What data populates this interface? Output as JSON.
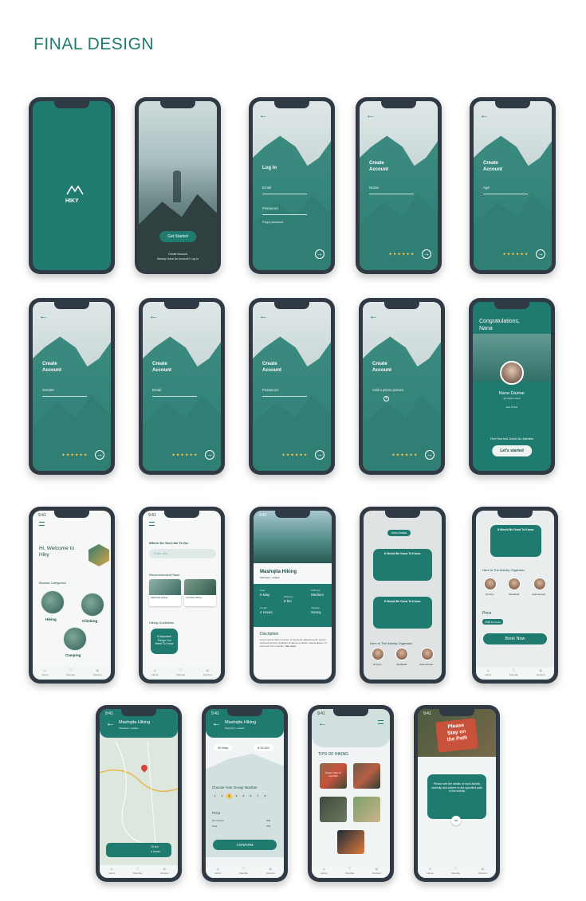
{
  "page": {
    "title": "FINAL DESIGN"
  },
  "colors": {
    "accent": "#1f7a6f",
    "dark": "#2f3a44",
    "star": "#f2c14e"
  },
  "splash": {
    "logo": "HIKY"
  },
  "onboarding": {
    "cta": "Get Started",
    "account_line": "Create Account",
    "signin_line": "Already Have An Account? Log In"
  },
  "login": {
    "title": "Log In",
    "email": "Email",
    "password": "Password",
    "forgot": "Forgot password"
  },
  "create": {
    "title_1": "Create",
    "title_2": "Account",
    "name": "Name",
    "age": "Age",
    "gender": "Gender",
    "email": "Email",
    "password": "Password",
    "photo": "Add a photo picture"
  },
  "steps": "✦✦✦✦✦✦",
  "congrats": {
    "title_1": "Congratulations,",
    "title_2": "Nana",
    "name": "Nana Dashar",
    "sub": "@ Nadine Nasa",
    "profile": "Edit Profile",
    "text": "Feel Free And Check Our Activities",
    "cta": "Let's started"
  },
  "home": {
    "time": "9:41",
    "greeting_1": "Hi, Welcome to",
    "greeting_2": "Hiky",
    "browse": "Browse Categories",
    "cat_1": "Hiking",
    "cat_2": "Climbing",
    "cat_3": "Camping"
  },
  "search": {
    "time": "9:41",
    "question": "Where Do You Like To Go:",
    "placeholder": "Enter city",
    "recommended": "Recommended Place",
    "place_1": "Mashqita Hiking",
    "place_2": "Fenawa Hiking",
    "guidelines": "Hiking Guidelines",
    "guide_card": "6 Important Things You Need To Know"
  },
  "detail": {
    "time": "9:41",
    "title": "Mashqita Hiking",
    "subtitle": "Mashqita / Latakia",
    "date_label": "Date",
    "date": "6 May",
    "distance_label": "Distance",
    "distance": "9 km",
    "difficulty_label": "Difficulty",
    "difficulty": "Medium",
    "length_label": "Length",
    "length": "4 Hours",
    "weather_label": "Weather",
    "weather": "Sunny",
    "desc_title": "Discription",
    "desc": "Lorem ipsum dolor sit amet, consectetur adipiscing elit, sed do eiusmod tempor incididunt ut labore et dolore magna aliqua. Ut enim ad minim veniam.",
    "see_more": "See more"
  },
  "activities": {
    "view_btn": "View Details",
    "card_1_title": "It Would Be Good To Know:",
    "card_2_title": "It Would Be Good To Know:",
    "organiser": "Here Is The Activity Organiser",
    "org_1": "Ali Sam",
    "org_2": "Ola Baddi",
    "org_3": "Anas Ahmed"
  },
  "booking": {
    "card_title": "It Would Be Good To Know:",
    "organiser": "Here Is The Activity Organiser",
    "org_1": "Ali Sam",
    "org_2": "Ola Baddi",
    "org_3": "Anas Ahmed",
    "price_label": "Price",
    "price": "20$",
    "per": "Per Person",
    "cta": "Book Now"
  },
  "map": {
    "time": "9:41",
    "title": "Mashqita Hiking",
    "subtitle": "Mashqita / Latakia",
    "distance": "10 km",
    "duration": "4 hours"
  },
  "group": {
    "time": "9:41",
    "title": "Mashqita Hiking",
    "subtitle": "Mashqita / Latakia",
    "date": "06 May",
    "time_slot": "8:00 AM",
    "choose": "Choose Your Group Number",
    "numbers": [
      "1",
      "2",
      "3",
      "4",
      "5",
      "6",
      "7",
      "8"
    ],
    "price_label": "Price",
    "per_person": "Per Person",
    "total": "Total",
    "per_val": "20$",
    "total_val": "20$",
    "cta": "CONFIRM"
  },
  "tips": {
    "time": "9:41",
    "title": "TIPS OF HIKING",
    "sign_text": "Please Stay on the Path"
  },
  "tip_detail": {
    "time": "9:41",
    "sign_1": "Please",
    "sign_2": "Stay on",
    "sign_3": "the Path",
    "text": "Please see the details of each activity carefully and adhere to the specified path of the activity",
    "ok": "ok"
  },
  "nav": {
    "home": "Home",
    "favorite": "Favorite",
    "account": "Account"
  }
}
